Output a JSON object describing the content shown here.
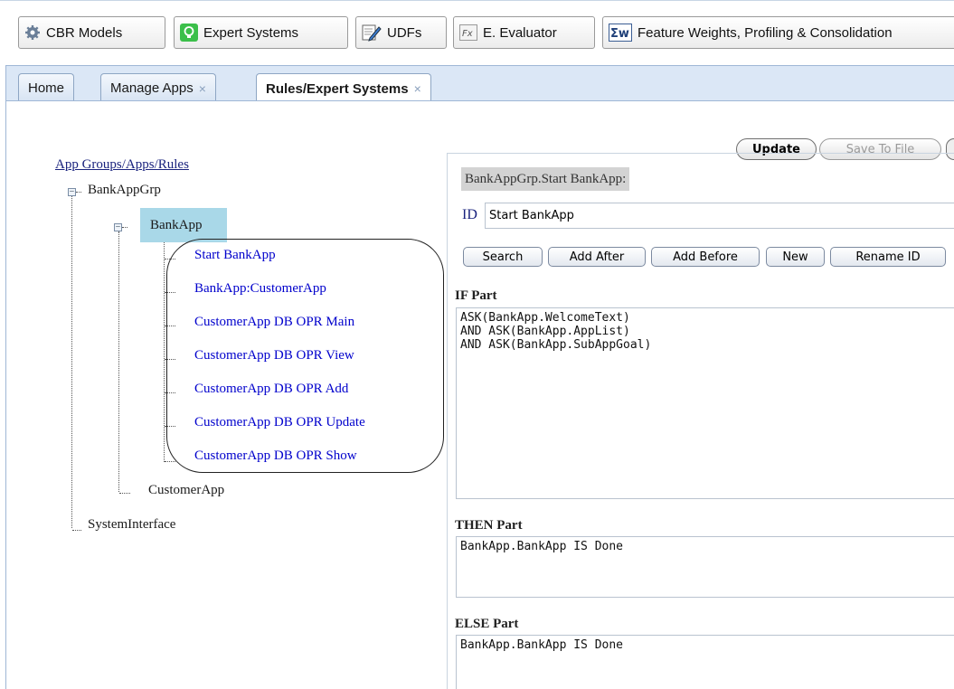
{
  "toolbar": {
    "buttons": [
      {
        "label": "CBR Models",
        "icon": "gear-icon"
      },
      {
        "label": "Expert Systems",
        "icon": "lightbulb-icon"
      },
      {
        "label": "UDFs",
        "icon": "edit-icon"
      },
      {
        "label": "E. Evaluator",
        "icon": "fx-icon"
      },
      {
        "label": "Feature Weights, Profiling & Consolidation",
        "icon": "sigma-w-icon"
      }
    ]
  },
  "tabs": [
    {
      "label": "Home"
    },
    {
      "label": "Manage Apps",
      "close": "×"
    },
    {
      "label": "Rules/Expert Systems",
      "close": "×"
    }
  ],
  "actions": {
    "update": "Update",
    "save_to_file": "Save To File"
  },
  "tree": {
    "root_label": "App Groups/Apps/Rules",
    "group": "BankAppGrp",
    "app": "BankApp",
    "rules": [
      "Start BankApp",
      "BankApp:CustomerApp",
      "CustomerApp DB OPR Main",
      "CustomerApp DB OPR View",
      "CustomerApp DB OPR Add",
      "CustomerApp DB OPR Update",
      "CustomerApp DB OPR Show"
    ],
    "customer_app": "CustomerApp",
    "system_interface": "SystemInterface"
  },
  "editor": {
    "header": "BankAppGrp.Start BankApp:",
    "id_label": "ID",
    "id_value": "Start BankApp",
    "buttons": [
      "Search",
      "Add After",
      "Add Before",
      "New",
      "Rename ID"
    ],
    "if_label": "IF Part",
    "if_text": "ASK(BankApp.WelcomeText)\nAND ASK(BankApp.AppList)\nAND ASK(BankApp.SubAppGoal)",
    "then_label": "THEN Part",
    "then_text": "BankApp.BankApp IS Done",
    "else_label": "ELSE Part",
    "else_text": "BankApp.BankApp IS Done"
  },
  "colors": {
    "rule_link": "#0000cc",
    "selected_bg": "#a9d8e8",
    "tab_bar": "#dbe7f6"
  }
}
